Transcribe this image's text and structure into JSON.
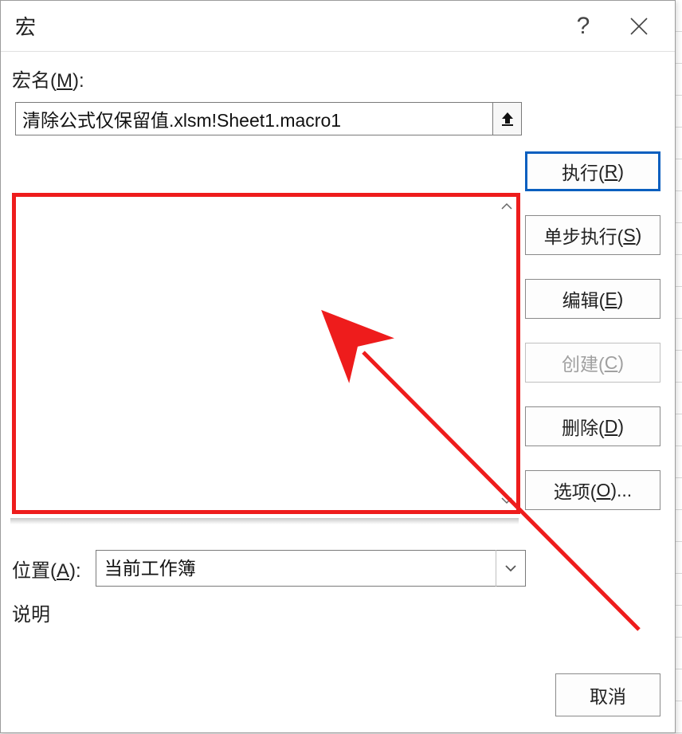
{
  "title": "宏",
  "macro_name": {
    "label_pre": "宏名(",
    "label_hot": "M",
    "label_post": "):",
    "value": "清除公式仅保留值.xlsm!Sheet1.macro1"
  },
  "listbox": {
    "items": []
  },
  "buttons": {
    "run_pre": "执行(",
    "run_hot": "R",
    "run_post": ")",
    "step_pre": "单步执行(",
    "step_hot": "S",
    "step_post": ")",
    "edit_pre": "编辑(",
    "edit_hot": "E",
    "edit_post": ")",
    "create_pre": "创建(",
    "create_hot": "C",
    "create_post": ")",
    "delete_pre": "删除(",
    "delete_hot": "D",
    "delete_post": ")",
    "options_pre": "选项(",
    "options_hot": "O",
    "options_post": ")...",
    "cancel": "取消"
  },
  "location": {
    "label_pre": "位置(",
    "label_hot": "A",
    "label_post": "):",
    "selected": "当前工作簿"
  },
  "description": {
    "label": "说明"
  },
  "annotation": {
    "highlight_color": "#ee1c1c"
  }
}
